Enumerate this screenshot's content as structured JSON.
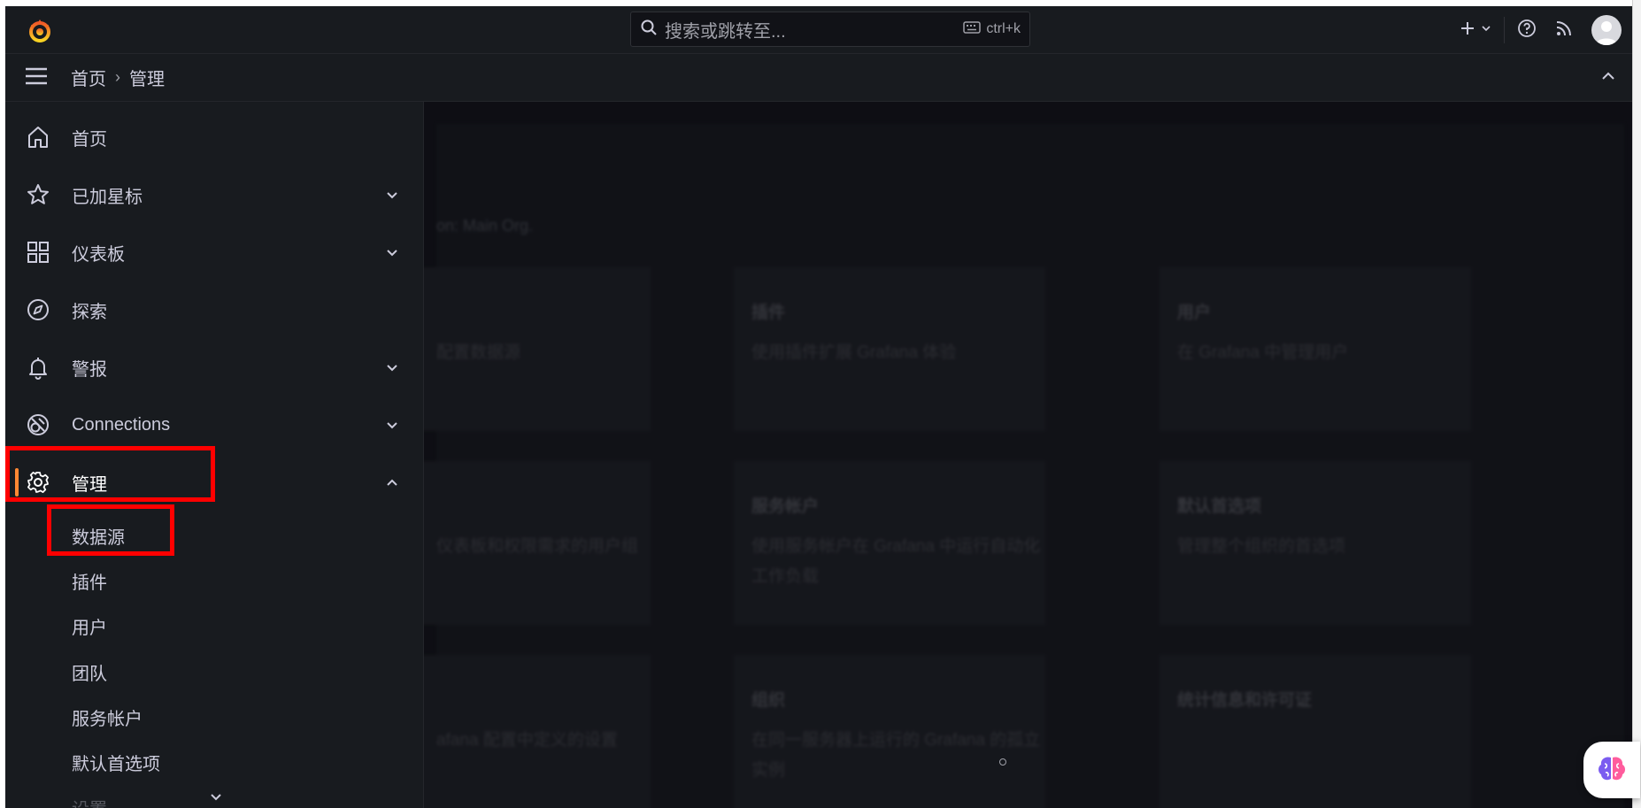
{
  "topbar": {
    "search_placeholder": "搜索或跳转至...",
    "shortcut": "ctrl+k",
    "icons": [
      "grafana-logo-icon",
      "search-icon",
      "keyboard-icon",
      "plus-icon",
      "chevron-down-icon",
      "help-icon",
      "rss-icon",
      "avatar"
    ]
  },
  "breadcrumb": {
    "items": [
      "首页",
      "管理"
    ],
    "separator": "›"
  },
  "sidebar": {
    "items": [
      {
        "label": "首页",
        "icon": "home-icon",
        "expandable": false
      },
      {
        "label": "已加星标",
        "icon": "star-icon",
        "expandable": true
      },
      {
        "label": "仪表板",
        "icon": "apps-icon",
        "expandable": true
      },
      {
        "label": "探索",
        "icon": "compass-icon",
        "expandable": true
      },
      {
        "label": "警报",
        "icon": "bell-icon",
        "expandable": true
      },
      {
        "label": "Connections",
        "icon": "connections-icon",
        "expandable": true
      },
      {
        "label": "管理",
        "icon": "gear-icon",
        "expandable": true,
        "expanded": true,
        "active": true
      }
    ],
    "sub_items": [
      "数据源",
      "插件",
      "用户",
      "团队",
      "服务帐户",
      "默认首选项",
      "设置"
    ]
  },
  "background": {
    "org_line": "on: Main Org.",
    "cards": [
      {
        "title": "",
        "desc": "配置数据源"
      },
      {
        "title": "插件",
        "desc": "使用插件扩展 Grafana 体验"
      },
      {
        "title": "用户",
        "desc": "在 Grafana 中管理用户"
      },
      {
        "title": "",
        "desc": "仪表板和权限需求的用户组"
      },
      {
        "title": "服务帐户",
        "desc": "使用服务帐户在 Grafana 中运行自动化工作负载"
      },
      {
        "title": "默认首选项",
        "desc": "管理整个组织的首选项"
      },
      {
        "title": "",
        "desc": "afana 配置中定义的设置"
      },
      {
        "title": "组织",
        "desc": "在同一服务器上运行的 Grafana 的孤立实例"
      },
      {
        "title": "统计信息和许可证",
        "desc": ""
      }
    ]
  },
  "colors": {
    "accent": "#ff8833",
    "highlight": "#ff0000",
    "background": "#111217",
    "panel": "#181b1f",
    "text": "#ccccdc"
  }
}
